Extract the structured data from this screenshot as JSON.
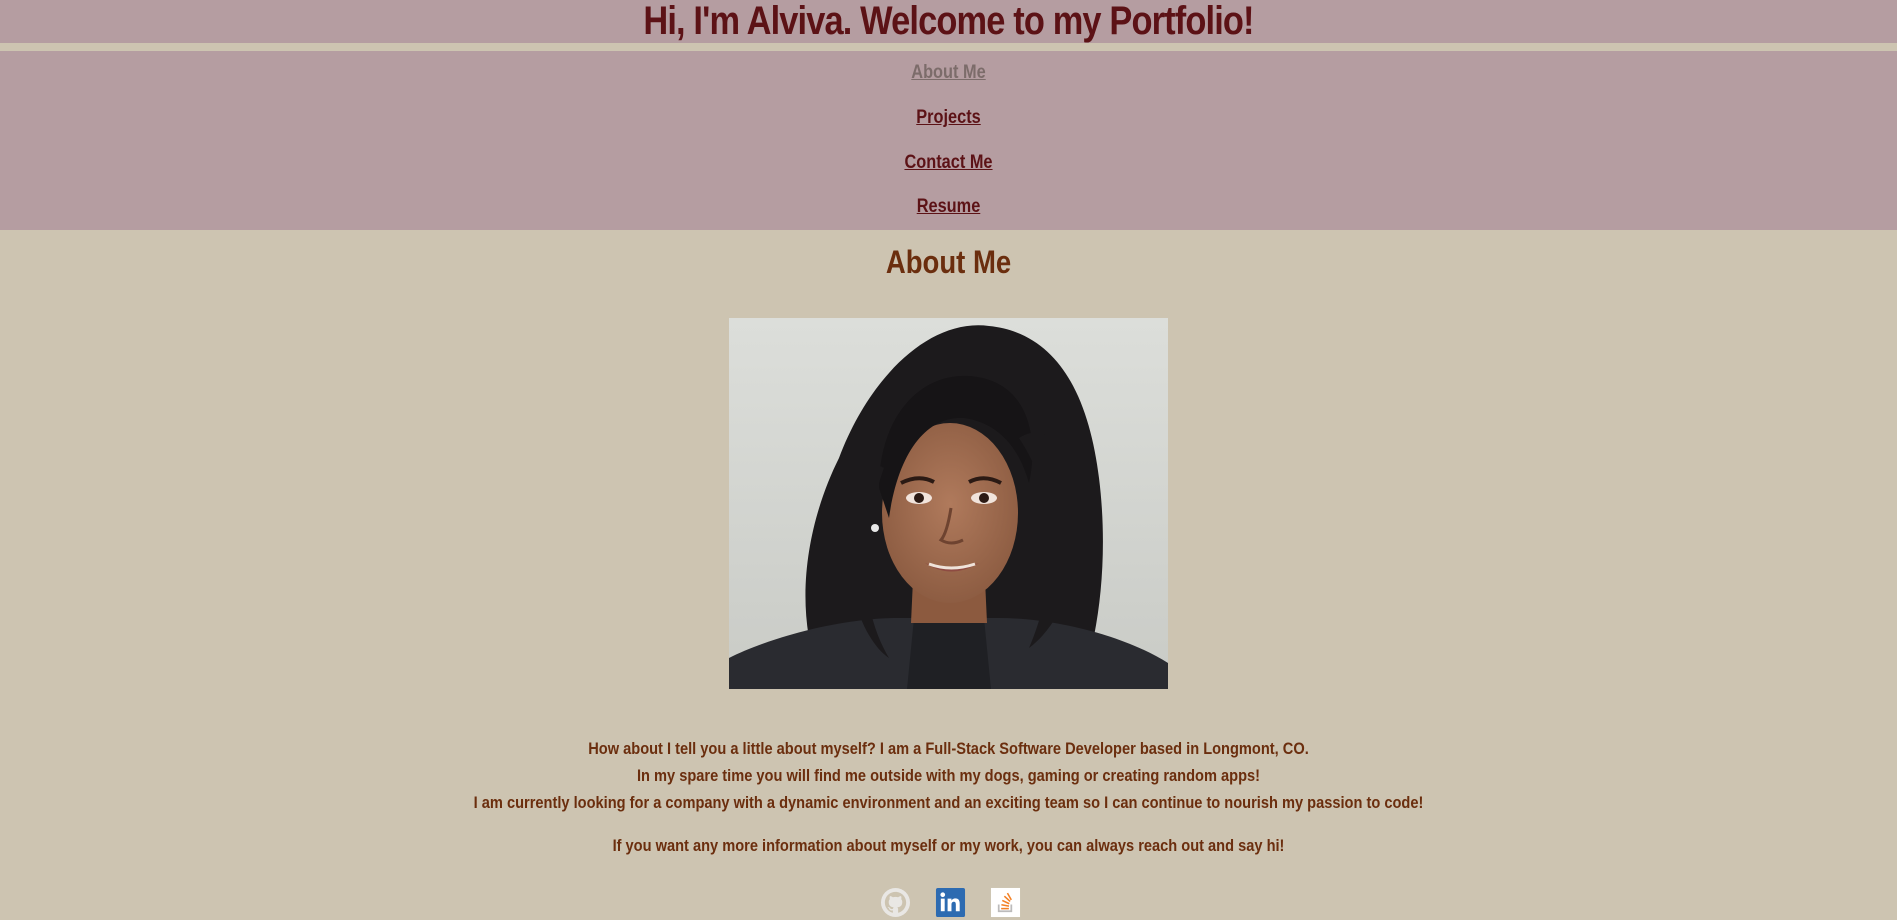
{
  "header": {
    "title": "Hi, I'm Alviva. Welcome to my Portfolio!"
  },
  "nav": {
    "items": [
      {
        "label": "About Me",
        "active": true
      },
      {
        "label": "Projects",
        "active": false
      },
      {
        "label": "Contact Me",
        "active": false
      },
      {
        "label": "Resume",
        "active": false
      }
    ]
  },
  "main": {
    "section_title": "About Me",
    "paragraphs": [
      "How about I tell you a little about myself? I am a Full-Stack Software Developer based in Longmont, CO.",
      "In my spare time you will find me outside with my dogs, gaming or creating random apps!",
      "I am currently looking for a company with a dynamic environment and an exciting team so I can continue to nourish my passion to code!",
      "If you want any more information about myself or my work, you can always reach out and say hi!"
    ],
    "socials": [
      {
        "icon": "github-icon"
      },
      {
        "icon": "linkedin-icon"
      },
      {
        "icon": "stackoverflow-icon"
      }
    ]
  },
  "colors": {
    "band": "#b59da1",
    "background": "#cdc4b1",
    "title": "#5c1216",
    "body_text": "#6b2e0e",
    "active_link": "#7c6c6a"
  }
}
